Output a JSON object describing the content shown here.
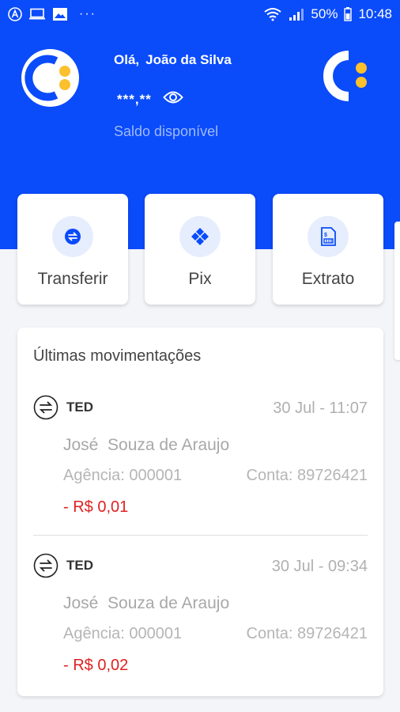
{
  "status_bar": {
    "dots": "···",
    "battery": "50%",
    "time": "10:48"
  },
  "header": {
    "greeting_prefix": "Olá,",
    "user_name": "João da Silva",
    "balance_masked": "***,**",
    "balance_label": "Saldo disponível"
  },
  "actions": [
    {
      "label": "Transferir",
      "icon": "transfer-icon"
    },
    {
      "label": "Pix",
      "icon": "pix-icon"
    },
    {
      "label": "Extrato",
      "icon": "statement-icon"
    }
  ],
  "transactions": {
    "title": "Últimas movimentações",
    "items": [
      {
        "type": "TED",
        "datetime": "30 Jul - 11:07",
        "name": "José  Souza de Araujo",
        "agency": "Agência: 000001",
        "account": "Conta: 89726421",
        "amount": "- R$ 0,01"
      },
      {
        "type": "TED",
        "datetime": "30 Jul - 09:34",
        "name": "José  Souza de Araujo",
        "agency": "Agência: 000001",
        "account": "Conta: 89726421",
        "amount": "- R$ 0,02"
      }
    ]
  },
  "colors": {
    "primary": "#0a4bfa",
    "accent": "#fbc02d",
    "negative": "#e02020",
    "background": "#f3f5f9"
  }
}
